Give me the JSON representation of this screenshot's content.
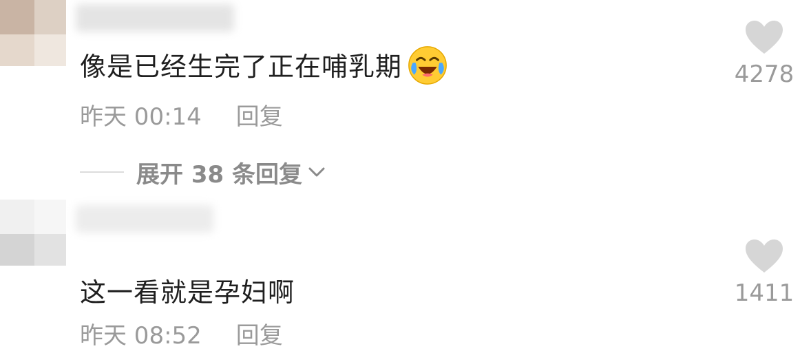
{
  "comments": [
    {
      "text": "像是已经生完了正在哺乳期",
      "emoji": "laughing-crying-emoji",
      "time": "昨天 00:14",
      "reply_label": "回复",
      "like_count": "4278"
    },
    {
      "text": "这一看就是孕妇啊",
      "time": "昨天 08:52",
      "reply_label": "回复",
      "like_count": "1411"
    }
  ],
  "expand_replies": {
    "label": "展开 38 条回复"
  },
  "icons": {
    "like": "heart-icon",
    "expand": "chevron-down-icon"
  },
  "colors": {
    "text_primary": "#1f1f1f",
    "text_secondary": "#9a9a9a",
    "heart_gray": "#d6d6d6",
    "emoji_yellow": "#ffcc33"
  }
}
